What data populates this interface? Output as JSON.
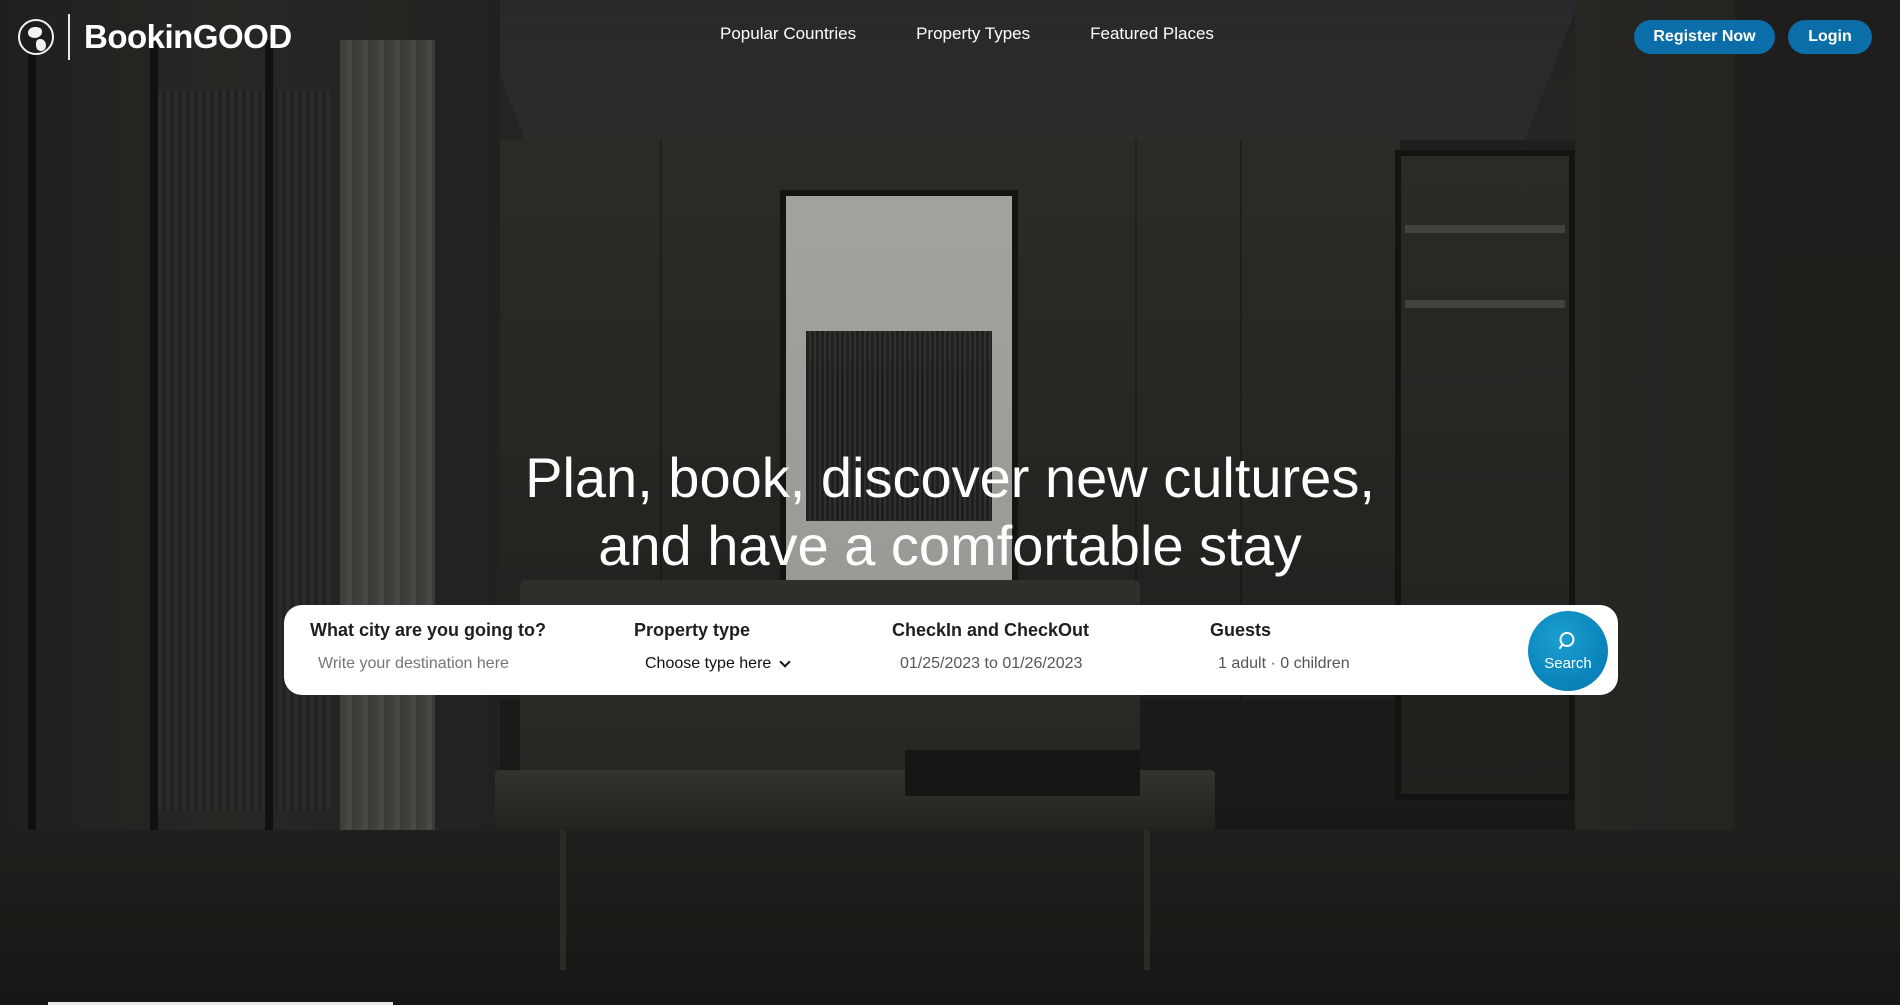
{
  "brand": {
    "name": "BookinGOOD",
    "icon": "globe-icon"
  },
  "nav": {
    "items": [
      {
        "label": "Popular Countries"
      },
      {
        "label": "Property Types"
      },
      {
        "label": "Featured Places"
      }
    ]
  },
  "auth": {
    "register_label": "Register Now",
    "login_label": "Login"
  },
  "hero": {
    "headline_line1": "Plan, book, discover new cultures,",
    "headline_line2": "and have a comfortable stay"
  },
  "search": {
    "destination": {
      "label": "What city are you going to?",
      "placeholder": "Write your destination here"
    },
    "property_type": {
      "label": "Property type",
      "value": "Choose type here"
    },
    "dates": {
      "label": "CheckIn and CheckOut",
      "value": "01/25/2023 to 01/26/2023"
    },
    "guests": {
      "label": "Guests",
      "value": "1 adult · 0 children"
    },
    "button_label": "Search",
    "button_icon": "search-icon"
  },
  "colors": {
    "accent": "#0b6ea8",
    "search_button": "#0a86bd",
    "text_light": "#ffffff"
  }
}
